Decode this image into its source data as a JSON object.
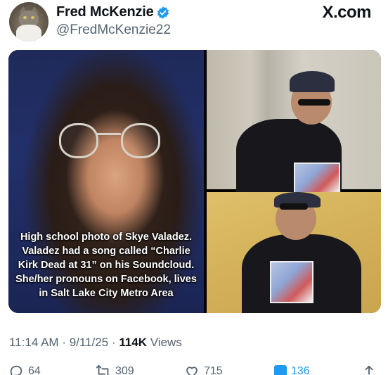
{
  "author": {
    "display_name": "Fred McKenzie",
    "handle": "@FredMcKenzie22",
    "verified_icon": "verified-badge-icon"
  },
  "brand": "X.com",
  "media": {
    "caption": "High school photo of Skye Valadez.\nValadez had a song called “Charlie\nKirk Dead at 31” on his Soundcloud.\nShe/her pronouns on Facebook, lives\nin Salt Lake City Metro Area"
  },
  "meta": {
    "time": "11:14 AM",
    "separator": "·",
    "date": "9/11/25",
    "views_count": "114K",
    "views_label": "Views"
  },
  "actions": {
    "replies": "64",
    "reposts": "309",
    "likes": "715",
    "bookmarks": "136"
  },
  "colors": {
    "accent": "#1d9bf0",
    "text_primary": "#0f1419",
    "text_secondary": "#536471"
  }
}
